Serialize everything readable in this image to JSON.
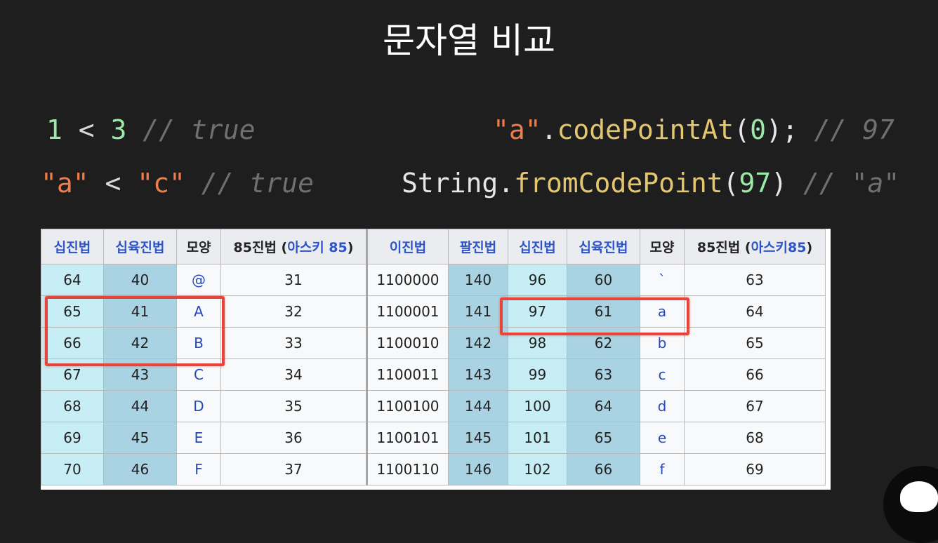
{
  "title": "문자열 비교",
  "code": {
    "line1_left": {
      "a": "1",
      "op": " < ",
      "b": "3",
      "comment": " // true"
    },
    "line2_left": {
      "a": "\"a\"",
      "op": " < ",
      "b": "\"c\"",
      "comment": " // true"
    },
    "line1_right": {
      "str": "\"a\"",
      "dot": ".",
      "fn": "codePointAt",
      "open": "(",
      "arg": "0",
      "close": ");",
      "comment": " // 97"
    },
    "line2_right": {
      "obj": "String",
      "dot": ".",
      "fn": "fromCodePoint",
      "open": "(",
      "arg": "97",
      "close": ")",
      "comment": " // \"a\""
    }
  },
  "table": {
    "headers_left": [
      "십진법",
      "십육진법",
      "모양",
      "85진법 (",
      "아스키 85",
      ")"
    ],
    "headers_right": [
      "이진법",
      "팔진법",
      "십진법",
      "십육진법",
      "모양",
      "85진법 (",
      "아스키85",
      ")"
    ],
    "rows": [
      [
        "64",
        "40",
        "@",
        "31",
        "1100000",
        "140",
        "96",
        "60",
        "`",
        "63"
      ],
      [
        "65",
        "41",
        "A",
        "32",
        "1100001",
        "141",
        "97",
        "61",
        "a",
        "64"
      ],
      [
        "66",
        "42",
        "B",
        "33",
        "1100010",
        "142",
        "98",
        "62",
        "b",
        "65"
      ],
      [
        "67",
        "43",
        "C",
        "34",
        "1100011",
        "143",
        "99",
        "63",
        "c",
        "66"
      ],
      [
        "68",
        "44",
        "D",
        "35",
        "1100100",
        "144",
        "100",
        "64",
        "d",
        "67"
      ],
      [
        "69",
        "45",
        "E",
        "36",
        "1100101",
        "145",
        "101",
        "65",
        "e",
        "68"
      ],
      [
        "70",
        "46",
        "F",
        "37",
        "1100110",
        "146",
        "102",
        "66",
        "f",
        "69"
      ]
    ]
  },
  "colors": {
    "highlight": "#e8453a",
    "link": "#2c54c8"
  },
  "logo_icon": "cat-logo-icon"
}
